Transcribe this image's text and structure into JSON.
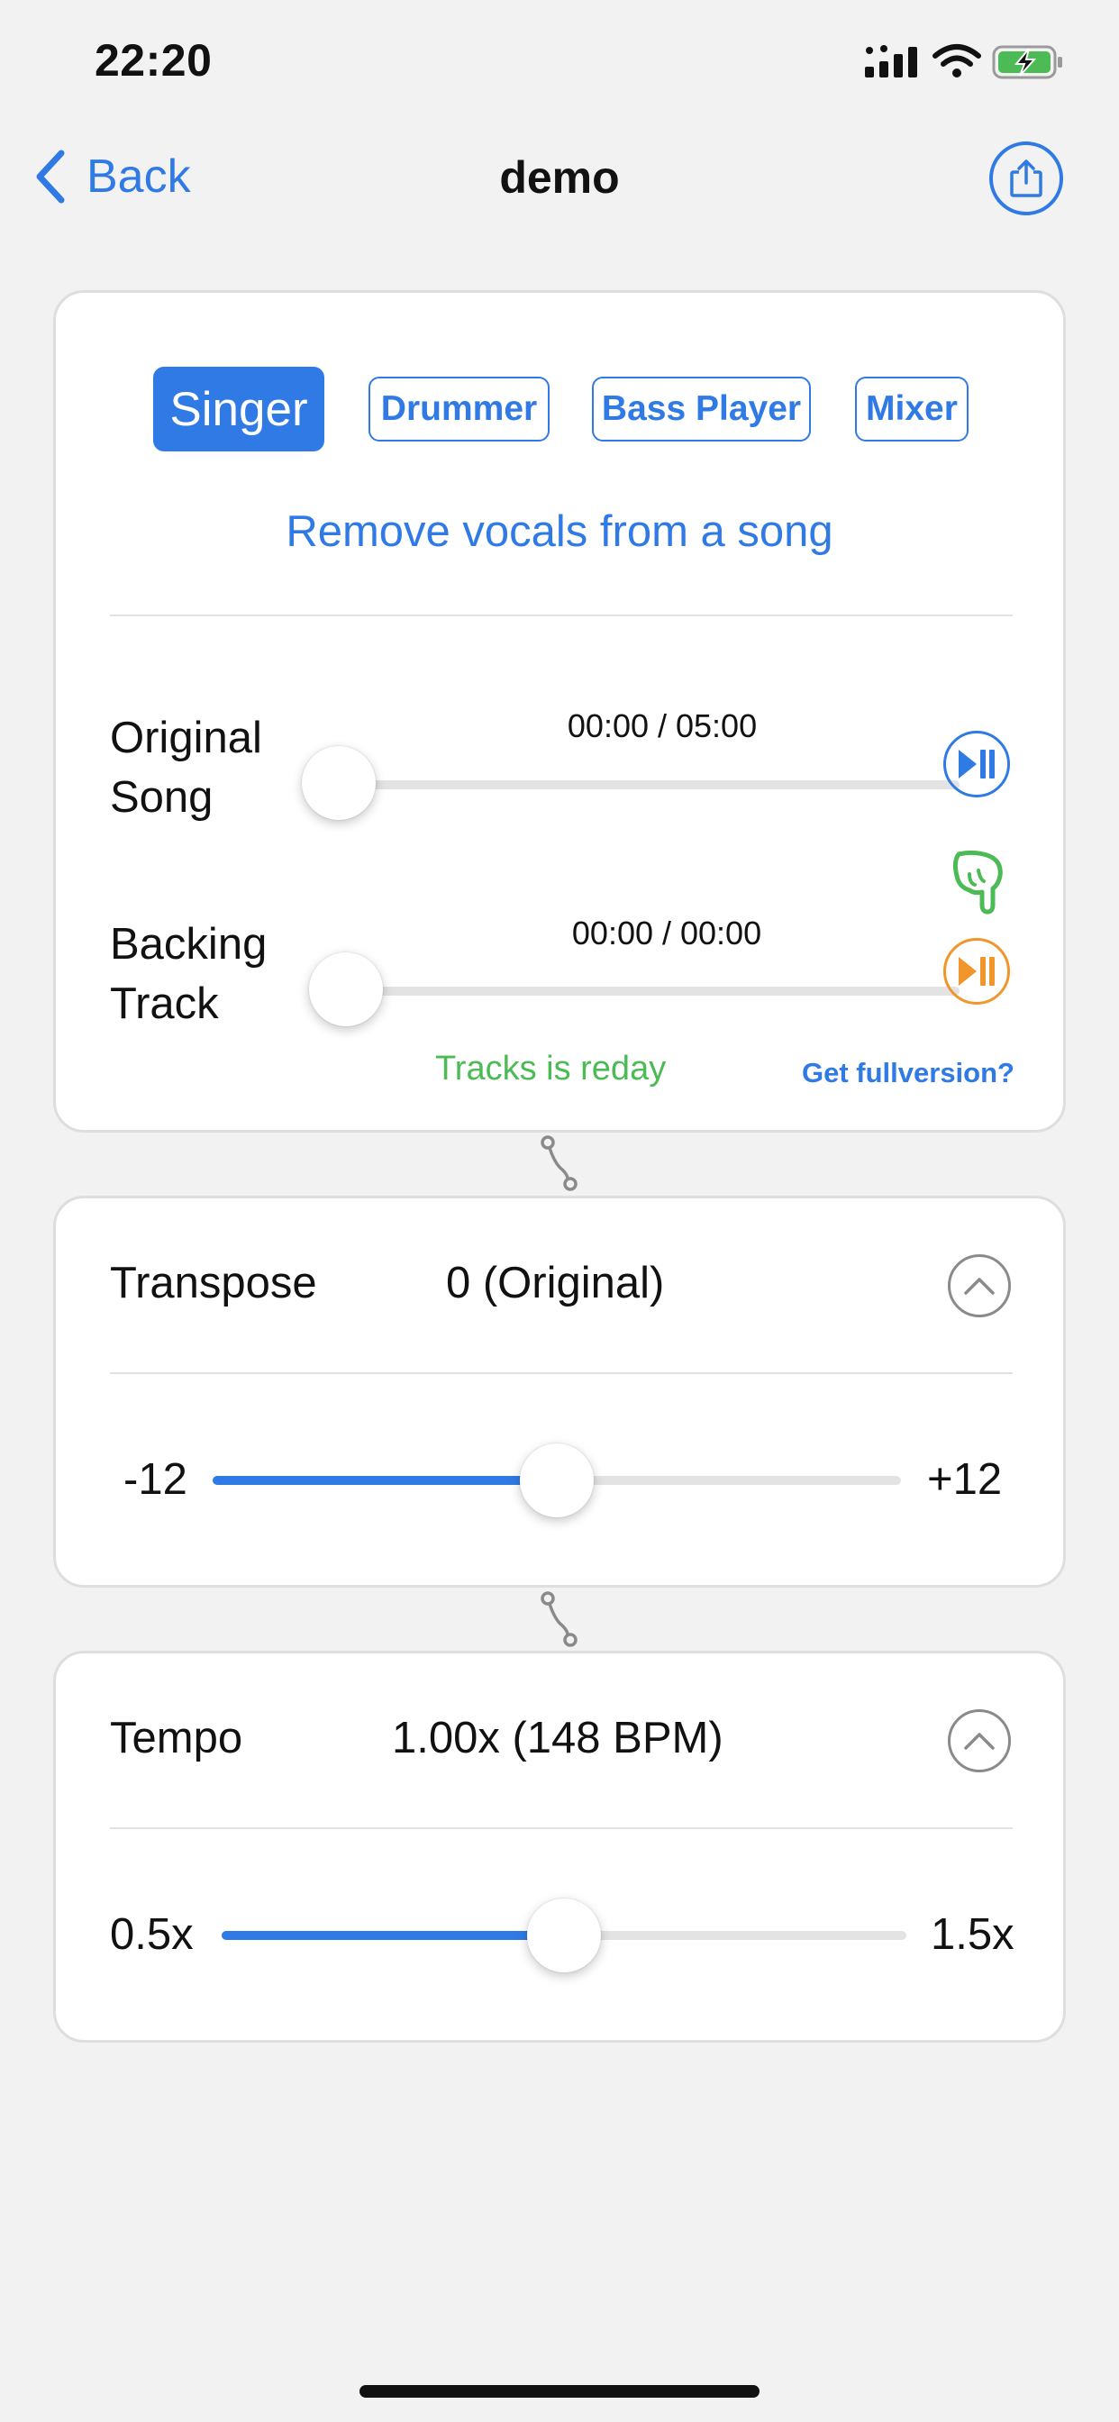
{
  "status_bar": {
    "time": "22:20",
    "icons": [
      "cellular-signal-icon",
      "wifi-icon",
      "battery-charging-icon"
    ],
    "battery_color": "#4cbb55"
  },
  "nav": {
    "back_label": "Back",
    "title": "demo",
    "share_icon": "share-icon"
  },
  "modes": {
    "tabs": [
      {
        "label": "Singer",
        "active": true
      },
      {
        "label": "Drummer",
        "active": false
      },
      {
        "label": "Bass Player",
        "active": false
      },
      {
        "label": "Mixer",
        "active": false
      }
    ],
    "description": "Remove vocals from a song"
  },
  "tracks": {
    "original": {
      "label_line1": "Original",
      "label_line2": "Song",
      "time": "00:00 / 05:00",
      "progress": 0,
      "play_icon": "play-pause-icon",
      "color": "#2f7ae5"
    },
    "hint_icon": "pointing-hand-icon",
    "backing": {
      "label_line1": "Backing",
      "label_line2": "Track",
      "time": "00:00 / 00:00",
      "progress": 0,
      "play_icon": "play-pause-icon",
      "color": "#f0962b"
    },
    "status_text": "Tracks is reday",
    "full_version_link": "Get fullversion?"
  },
  "transpose": {
    "label": "Transpose",
    "value": "0 (Original)",
    "min_label": "-12",
    "max_label": "+12",
    "min": -12,
    "max": 12,
    "current": 0
  },
  "tempo": {
    "label": "Tempo",
    "value": "1.00x (148 BPM)",
    "min_label": "0.5x",
    "max_label": "1.5x",
    "min": 0.5,
    "max": 1.5,
    "current": 1.0
  },
  "colors": {
    "accent": "#2f7ae5",
    "ready_green": "#4cbb55",
    "backing_orange": "#f0962b",
    "background": "#f2f2f2"
  }
}
